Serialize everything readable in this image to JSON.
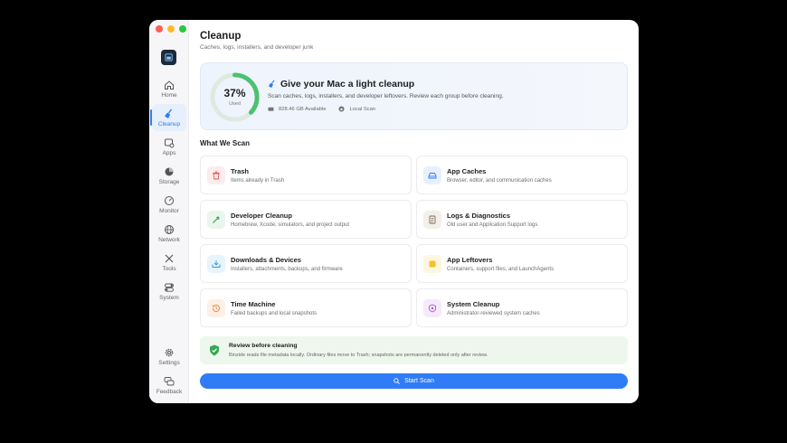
{
  "sidebar": {
    "items": [
      {
        "label": "Home",
        "icon": "house-icon"
      },
      {
        "label": "Cleanup",
        "icon": "broom-icon",
        "active": true
      },
      {
        "label": "Apps",
        "icon": "apps-icon"
      },
      {
        "label": "Storage",
        "icon": "pie-chart-icon"
      },
      {
        "label": "Monitor",
        "icon": "gauge-icon"
      },
      {
        "label": "Network",
        "icon": "globe-icon"
      },
      {
        "label": "Tools",
        "icon": "wrench-screwdriver-icon"
      },
      {
        "label": "System",
        "icon": "toggles-icon"
      }
    ],
    "bottom": [
      {
        "label": "Settings",
        "icon": "gear-icon"
      },
      {
        "label": "Feedback",
        "icon": "chat-bubbles-icon"
      }
    ]
  },
  "header": {
    "title": "Cleanup",
    "subtitle": "Caches, logs, installers, and developer junk"
  },
  "hero": {
    "percent": "37%",
    "percent_value": 0.37,
    "percent_label": "Used",
    "title": "Give your Mac a light cleanup",
    "description": "Scan caches, logs, installers, and developer leftovers. Review each group before cleaning.",
    "available": "828.46 GB Available",
    "scan_type": "Local Scan"
  },
  "section_title": "What We Scan",
  "cards": [
    {
      "title": "Trash",
      "subtitle": "Items already in Trash",
      "icon": "trash-icon",
      "color": "#e5534b",
      "bg": "#fdecec"
    },
    {
      "title": "App Caches",
      "subtitle": "Browser, editor, and communication caches",
      "icon": "drive-icon",
      "color": "#2f7cf6",
      "bg": "#e8f0fe"
    },
    {
      "title": "Developer Cleanup",
      "subtitle": "Homebrew, Xcode, simulators, and project output",
      "icon": "hammer-icon",
      "color": "#3aa55d",
      "bg": "#e9f6ed"
    },
    {
      "title": "Logs & Diagnostics",
      "subtitle": "Old user and Application Support logs",
      "icon": "document-icon",
      "color": "#7a6a55",
      "bg": "#f3efe9"
    },
    {
      "title": "Downloads & Devices",
      "subtitle": "Installers, attachments, backups, and firmware",
      "icon": "tray-download-icon",
      "color": "#2f9bd6",
      "bg": "#e6f4fb"
    },
    {
      "title": "App Leftovers",
      "subtitle": "Containers, support files, and LaunchAgents",
      "icon": "box-icon",
      "color": "#f2c230",
      "bg": "#fdf7e0"
    },
    {
      "title": "Time Machine",
      "subtitle": "Failed backups and local snapshots",
      "icon": "clock-history-icon",
      "color": "#e8833a",
      "bg": "#fdf0e6"
    },
    {
      "title": "System Cleanup",
      "subtitle": "Administrator-reviewed system caches",
      "icon": "shield-icon",
      "color": "#a855c7",
      "bg": "#f5eafa"
    }
  ],
  "notice": {
    "title": "Review before cleaning",
    "text": "Binzide reads file metadata locally. Ordinary files move to Trash; snapshots are permanently deleted only after review."
  },
  "scan_button": "Start Scan",
  "colors": {
    "accent": "#2f7cf6",
    "gauge": "#4cc16e",
    "success": "#34a853"
  }
}
